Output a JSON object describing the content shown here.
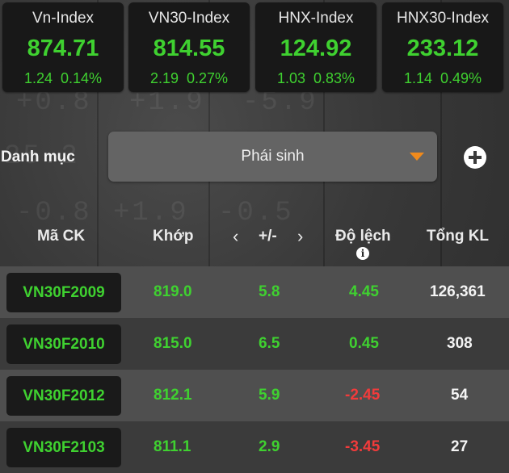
{
  "indices": [
    {
      "name": "Vn-Index",
      "value": "874.71",
      "change": "1.24",
      "percent": "0.14%"
    },
    {
      "name": "VN30-Index",
      "value": "814.55",
      "change": "2.19",
      "percent": "0.27%"
    },
    {
      "name": "HNX-Index",
      "value": "124.92",
      "change": "1.03",
      "percent": "0.83%"
    },
    {
      "name": "HNX30-Index",
      "value": "233.12",
      "change": "1.14",
      "percent": "0.49%"
    }
  ],
  "category": {
    "label": "Danh mục",
    "selected": "Phái sinh",
    "icon": "chevron-down-icon",
    "add_icon": "plus-circle-icon"
  },
  "table": {
    "headers": {
      "code": "Mã CK",
      "match": "Khớp",
      "prev_arrow": "‹",
      "change": "+/-",
      "next_arrow": "›",
      "deviation": "Độ lệch",
      "total_volume": "Tổng KL",
      "info_icon": "i"
    },
    "rows": [
      {
        "code": "VN30F2009",
        "match": "819.0",
        "change": "5.8",
        "deviation": "4.45",
        "deviation_dir": "up",
        "volume": "126,361"
      },
      {
        "code": "VN30F2010",
        "match": "815.0",
        "change": "6.5",
        "deviation": "0.45",
        "deviation_dir": "up",
        "volume": "308"
      },
      {
        "code": "VN30F2012",
        "match": "812.1",
        "change": "5.9",
        "deviation": "-2.45",
        "deviation_dir": "down",
        "volume": "54"
      },
      {
        "code": "VN30F2103",
        "match": "811.1",
        "change": "2.9",
        "deviation": "-3.45",
        "deviation_dir": "down",
        "volume": "27"
      }
    ]
  },
  "colors": {
    "up": "#3fd130",
    "down": "#f23b3b",
    "accent": "#f08a1c"
  }
}
